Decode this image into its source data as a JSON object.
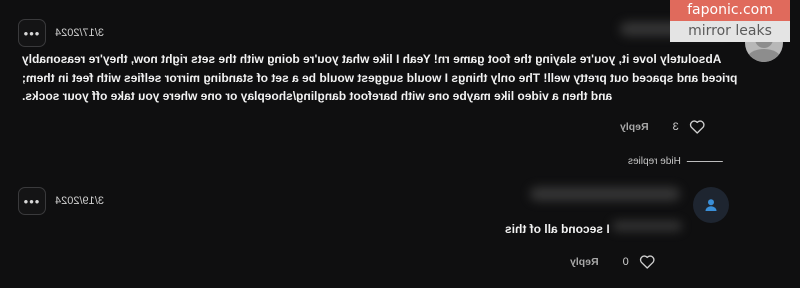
{
  "watermark": {
    "line1": "faponic.com",
    "line2": "mirror leaks"
  },
  "comments": [
    {
      "date": "3/17/2024",
      "more_label": "•••",
      "text_lines": [
        "Absolutely love it, you're slaying the foot game rn! Yeah I like what you're doing with the sets right now, they're reasonably",
        "priced and spaced out pretty well! The only things I would suggest would be a set of standing mirror selfies with feet in them;",
        "and then a video like maybe one with barefoot dangling/shoeplay or one where you take off your socks."
      ],
      "like_count": "3",
      "reply_label": "Reply"
    },
    {
      "date": "3/19/2024",
      "more_label": "•••",
      "text_lines": [
        "I second all of this"
      ],
      "like_count": "0",
      "reply_label": "Reply"
    }
  ],
  "hide_replies_label": "Hide replies"
}
